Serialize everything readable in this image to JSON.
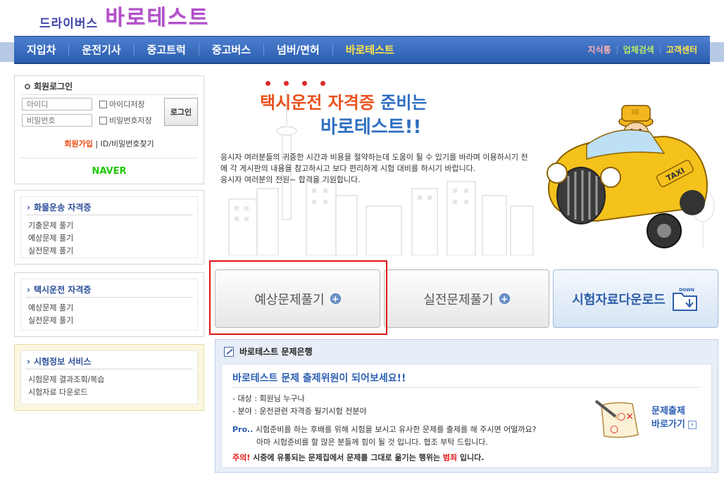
{
  "header": {
    "logo_sub": "드라이버스",
    "logo_main": "바로테스트"
  },
  "nav": {
    "items": [
      {
        "label": "지입차"
      },
      {
        "label": "운전기사"
      },
      {
        "label": "중고트럭"
      },
      {
        "label": "중고버스"
      },
      {
        "label": "넘버/면허"
      },
      {
        "label": "바로테스트"
      }
    ],
    "utility": [
      {
        "label": "지식통",
        "color": "#ffb0b0"
      },
      {
        "label": "업체검색",
        "color": "#b6e86a"
      },
      {
        "label": "고객센터",
        "color": "#ffe54a"
      }
    ]
  },
  "login": {
    "title": "회원로그인",
    "id_placeholder": "아이디",
    "pw_placeholder": "비밀번호",
    "save_id": "아이디저장",
    "save_pw": "비밀번호저장",
    "login_button": "로그인",
    "join": "회원가입",
    "divider": "|",
    "find": "ID/비밀번호찾기",
    "naver": "NAVER"
  },
  "side": {
    "cargo": {
      "title": "화물운송 자격증",
      "items": [
        "기출문제 풀기",
        "예상문제 풀기",
        "실전문제 풀기"
      ]
    },
    "taxi": {
      "title": "택시운전 자격증",
      "items": [
        "예상문제 풀기",
        "실전문제 풀기"
      ]
    },
    "exam_info": {
      "title": "시험정보 서비스",
      "items": [
        "시험문제 결과조회/복습",
        "시험자료 다운로드"
      ]
    }
  },
  "hero": {
    "title_red": "택시운전 자격증",
    "title_blue": " 준비는",
    "title2": "바로테스트!!",
    "body": "응시자 여러분들의 귀중한 시간과 비용을 절약하는데 도움이 될 수 있기를 바라며 이용하시기 전에 각 게시판의 내용을 참고하시고 보다 편리하게 시험 대비를 하시기 바랍니다.",
    "body2": "응시자 여러분의 전원~ 합격을 기원합니다.",
    "taxi_sign": "TAXI"
  },
  "buttons": {
    "expected": "예상문제풀기",
    "practice": "실전문제풀기",
    "download": "시험자료다운로드",
    "download_badge": "DOWN"
  },
  "bank": {
    "title": "바로테스트 문제은행",
    "headline": "바로테스트 문제 출제위원이 되어보세요!!",
    "target_label": "- 대상 : ",
    "target_value": "회원님 누구나",
    "field_label": "- 분야 : ",
    "field_value": "운전관련 자격증 필기시험 전분야",
    "pro_label": "Pro..",
    "pro_text": "시험준비를 하는 후배를 위해 시험을 보시고 유사한 문제를 출제를 해 주시면 어떨까요?",
    "pro_text2": "아마 시험준비를 할 많은 분들께 힘이 될 것 입니다. 협조 부탁 드립니다.",
    "warn_label": "주의!",
    "warn_text1": " 시중에 유통되는 문제집에서 문제를 그대로 옮기는 행위는 ",
    "warn_bold": "범죄",
    "warn_text2": " 입니다.",
    "cta_line1": "문제출제",
    "cta_line2": "바로가기"
  }
}
